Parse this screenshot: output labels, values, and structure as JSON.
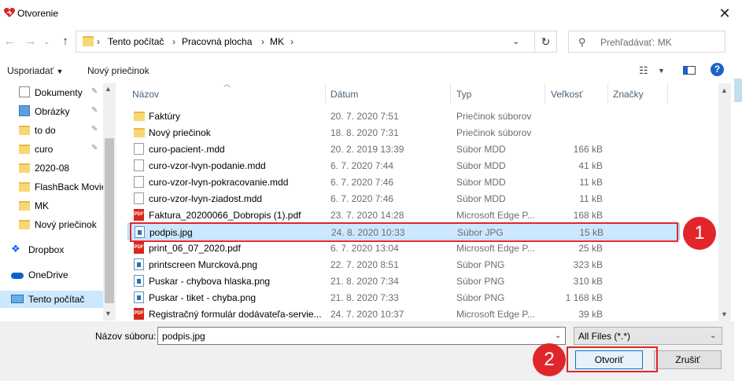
{
  "window": {
    "title": "Otvorenie"
  },
  "address": {
    "crumbs": [
      "Tento počítač",
      "Pracovná plocha",
      "MK"
    ]
  },
  "search": {
    "placeholder": "Prehľadávať: MK"
  },
  "toolbar": {
    "organize_label": "Usporiadať",
    "new_folder_label": "Nový priečinok"
  },
  "sidebar": {
    "items": [
      {
        "label": "Dokumenty",
        "icon": "documents-icon",
        "pinned": true
      },
      {
        "label": "Obrázky",
        "icon": "pictures-icon",
        "pinned": true
      },
      {
        "label": "to do",
        "icon": "folder-icon",
        "pinned": true
      },
      {
        "label": "curo",
        "icon": "folder-icon",
        "pinned": true
      },
      {
        "label": "2020-08",
        "icon": "folder-icon",
        "pinned": false
      },
      {
        "label": "FlashBack Movie",
        "icon": "folder-icon",
        "pinned": false
      },
      {
        "label": "MK",
        "icon": "folder-icon",
        "pinned": false
      },
      {
        "label": "Nový priečinok",
        "icon": "folder-icon",
        "pinned": false
      },
      {
        "label": "Dropbox",
        "icon": "dropbox-icon",
        "pinned": false
      },
      {
        "label": "OneDrive",
        "icon": "onedrive-icon",
        "pinned": false
      },
      {
        "label": "Tento počítač",
        "icon": "computer-icon",
        "pinned": false
      }
    ]
  },
  "columns": {
    "name": "Názov",
    "date": "Dátum",
    "type": "Typ",
    "size": "Veľkosť",
    "tags": "Značky"
  },
  "files": [
    {
      "name": "Faktúry",
      "date": "20. 7. 2020 7:51",
      "type": "Priečinok súborov",
      "size": "",
      "icon": "folder"
    },
    {
      "name": "Nový priečinok",
      "date": "18. 8. 2020 7:31",
      "type": "Priečinok súborov",
      "size": "",
      "icon": "folder"
    },
    {
      "name": "curo-pacient-.mdd",
      "date": "20. 2. 2019 13:39",
      "type": "Súbor MDD",
      "size": "166 kB",
      "icon": "file"
    },
    {
      "name": "curo-vzor-lvyn-podanie.mdd",
      "date": "6. 7. 2020 7:44",
      "type": "Súbor MDD",
      "size": "41 kB",
      "icon": "file"
    },
    {
      "name": "curo-vzor-lvyn-pokracovanie.mdd",
      "date": "6. 7. 2020 7:46",
      "type": "Súbor MDD",
      "size": "11 kB",
      "icon": "file"
    },
    {
      "name": "curo-vzor-lvyn-ziadost.mdd",
      "date": "6. 7. 2020 7:46",
      "type": "Súbor MDD",
      "size": "11 kB",
      "icon": "file"
    },
    {
      "name": "Faktura_20200066_Dobropis (1).pdf",
      "date": "23. 7. 2020 14:28",
      "type": "Microsoft Edge P...",
      "size": "168 kB",
      "icon": "pdf"
    },
    {
      "name": "podpis.jpg",
      "date": "24. 8. 2020 10:33",
      "type": "Súbor JPG",
      "size": "15 kB",
      "icon": "image",
      "selected": true
    },
    {
      "name": "print_06_07_2020.pdf",
      "date": "6. 7. 2020 13:04",
      "type": "Microsoft Edge P...",
      "size": "25 kB",
      "icon": "pdf"
    },
    {
      "name": "printscreen Murcková.png",
      "date": "22. 7. 2020 8:51",
      "type": "Súbor PNG",
      "size": "323 kB",
      "icon": "image"
    },
    {
      "name": "Puskar - chybova hlaska.png",
      "date": "21. 8. 2020 7:34",
      "type": "Súbor PNG",
      "size": "310 kB",
      "icon": "image"
    },
    {
      "name": "Puskar - tiket - chyba.png",
      "date": "21. 8. 2020 7:33",
      "type": "Súbor PNG",
      "size": "1 168 kB",
      "icon": "image"
    },
    {
      "name": "Registračný formulár dodávateľa-servie...",
      "date": "24. 7. 2020 10:37",
      "type": "Microsoft Edge P...",
      "size": "39 kB",
      "icon": "pdf"
    }
  ],
  "footer": {
    "filename_label": "Názov súboru:",
    "filename_value": "podpis.jpg",
    "filter_value": "All Files (*.*)",
    "open_label": "Otvoriť",
    "cancel_label": "Zrušiť"
  },
  "annotations": {
    "badge1": "1",
    "badge2": "2"
  },
  "colors": {
    "selection": "#cce8ff",
    "highlight": "#e0262b",
    "accent": "#0078d7"
  },
  "pdf_icon_text": "PDF"
}
